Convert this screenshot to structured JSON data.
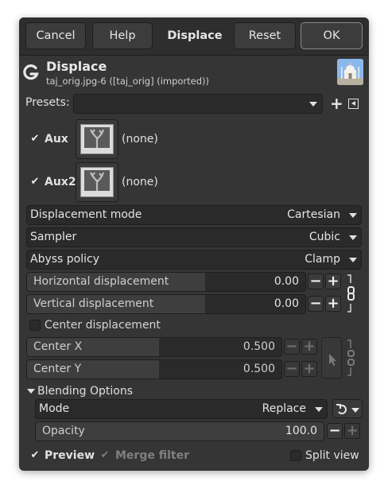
{
  "header": {
    "cancel": "Cancel",
    "help": "Help",
    "title": "Displace",
    "reset": "Reset",
    "ok": "OK"
  },
  "filter": {
    "title": "Displace",
    "subtitle": "taj_orig.jpg-6 ([taj_orig] (imported))"
  },
  "presets": {
    "label": "Presets:",
    "value": ""
  },
  "aux": {
    "label": "Aux",
    "checked": true,
    "value": "(none)"
  },
  "aux2": {
    "label": "Aux2",
    "checked": true,
    "value": "(none)"
  },
  "displacement_mode": {
    "label": "Displacement mode",
    "value": "Cartesian"
  },
  "sampler": {
    "label": "Sampler",
    "value": "Cubic"
  },
  "abyss_policy": {
    "label": "Abyss policy",
    "value": "Clamp"
  },
  "horizontal_displacement": {
    "label": "Horizontal displacement",
    "value": "0.00"
  },
  "vertical_displacement": {
    "label": "Vertical displacement",
    "value": "0.00"
  },
  "center_displacement": {
    "label": "Center displacement",
    "checked": false
  },
  "center_x": {
    "label": "Center X",
    "value": "0.500"
  },
  "center_y": {
    "label": "Center Y",
    "value": "0.500"
  },
  "blending": {
    "header": "Blending Options",
    "mode": {
      "label": "Mode",
      "value": "Replace"
    },
    "opacity": {
      "label": "Opacity",
      "value": "100.0"
    }
  },
  "footer": {
    "preview": {
      "label": "Preview",
      "checked": true
    },
    "merge_filter": {
      "label": "Merge filter",
      "checked": true,
      "enabled": false
    },
    "split_view": {
      "label": "Split view",
      "checked": false
    }
  },
  "colors": {
    "dialog_bg": "#353535",
    "header_bg": "#2e2e2e",
    "field_bg": "#2a2a2a",
    "text": "#e4e4e4"
  }
}
